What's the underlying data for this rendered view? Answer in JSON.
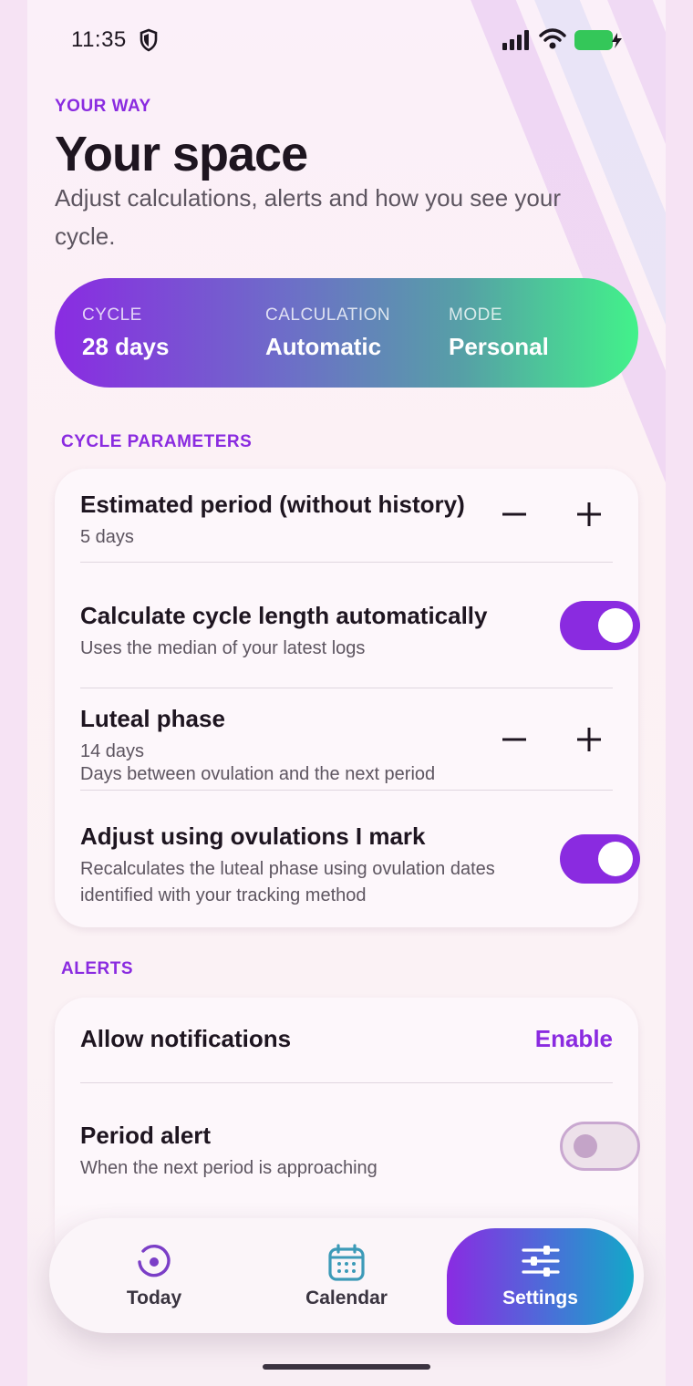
{
  "status_bar": {
    "time": "11:35"
  },
  "header": {
    "eyebrow": "YOUR WAY",
    "title": "Your space",
    "subtitle": "Adjust calculations, alerts and how you see your cycle."
  },
  "summary": {
    "cycle_label": "CYCLE",
    "cycle_value": "28 days",
    "calc_label": "CALCULATION",
    "calc_value": "Automatic",
    "mode_label": "MODE",
    "mode_value": "Personal"
  },
  "cycle_parameters": {
    "heading": "CYCLE PARAMETERS",
    "estimated_period": {
      "title": "Estimated period (without history)",
      "value": "5 days"
    },
    "auto_length": {
      "title": "Calculate cycle length automatically",
      "subtitle": "Uses the median of your latest logs",
      "enabled": true
    },
    "luteal": {
      "title": "Luteal phase",
      "value": "14 days",
      "subtitle": "Days between ovulation and the next period"
    },
    "ovulation_adjust": {
      "title": "Adjust using ovulations I mark",
      "subtitle": "Recalculates the luteal phase using ovulation dates identified with your tracking method",
      "enabled": true
    }
  },
  "alerts": {
    "heading": "ALERTS",
    "notifications": {
      "title": "Allow notifications",
      "action": "Enable"
    },
    "period_alert": {
      "title": "Period alert",
      "subtitle": "When the next period is approaching",
      "enabled": false
    }
  },
  "nav": {
    "today": "Today",
    "calendar": "Calendar",
    "settings": "Settings",
    "active": "settings"
  },
  "colors": {
    "accent": "#8a2be0",
    "toggle_on": "#8a2be0",
    "toggle_off": "#ede1ea"
  }
}
